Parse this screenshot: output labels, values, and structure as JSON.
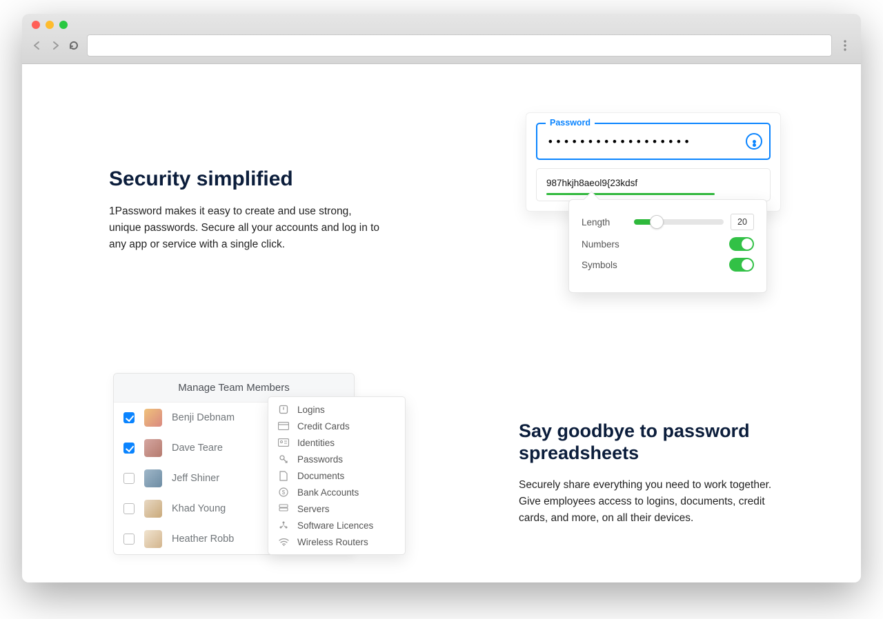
{
  "section1": {
    "heading": "Security simplified",
    "body": "1Password makes it easy to create and use strong, unique passwords. Secure all your accounts and log in to any app or service with a single click."
  },
  "password_panel": {
    "field_label": "Password",
    "masked_value": "••••••••••••••••••",
    "generated_value": "987hkjh8aeol9{23kdsf",
    "length_label": "Length",
    "length_value": "20",
    "numbers_label": "Numbers",
    "symbols_label": "Symbols",
    "numbers_on": true,
    "symbols_on": true
  },
  "team_panel": {
    "title": "Manage Team Members",
    "members": [
      {
        "name": "Benji Debnam",
        "checked": true
      },
      {
        "name": "Dave Teare",
        "checked": true
      },
      {
        "name": "Jeff Shiner",
        "checked": false
      },
      {
        "name": "Khad Young",
        "checked": false
      },
      {
        "name": "Heather Robb",
        "checked": false
      }
    ]
  },
  "categories": [
    "Logins",
    "Credit Cards",
    "Identities",
    "Passwords",
    "Documents",
    "Bank Accounts",
    "Servers",
    "Software Licences",
    "Wireless Routers"
  ],
  "section2": {
    "heading": "Say goodbye to password spreadsheets",
    "body": "Securely share everything you need to work together. Give employees access to logins, documents, credit cards, and more, on all their devices."
  }
}
